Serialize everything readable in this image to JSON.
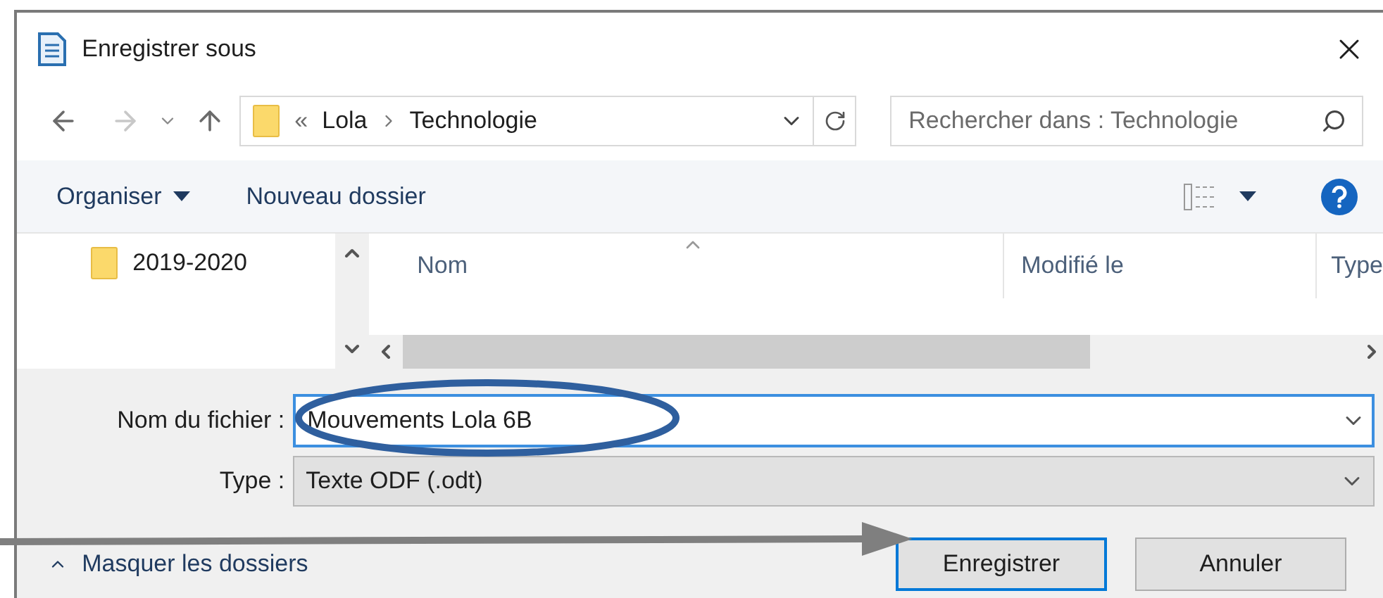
{
  "window": {
    "title": "Enregistrer sous"
  },
  "address_bar": {
    "prefix": "«",
    "path": [
      {
        "label": "Lola"
      },
      {
        "label": "Technologie"
      }
    ]
  },
  "search": {
    "placeholder": "Rechercher dans : Technologie"
  },
  "toolbar": {
    "organize": "Organiser",
    "new_folder": "Nouveau dossier"
  },
  "navigation_pane": {
    "items": [
      {
        "label": "2019-2020"
      }
    ]
  },
  "file_list": {
    "columns": [
      "Nom",
      "Modifié le",
      "Type"
    ]
  },
  "form": {
    "filename_label": "Nom du fichier :",
    "filename_value": "Mouvements Lola 6B",
    "type_label": "Type :",
    "type_value": "Texte ODF (.odt)"
  },
  "hide_folders": "Masquer les dossiers",
  "buttons": [
    {
      "label": "Enregistrer",
      "default": true
    },
    {
      "label": "Annuler",
      "default": false
    }
  ]
}
